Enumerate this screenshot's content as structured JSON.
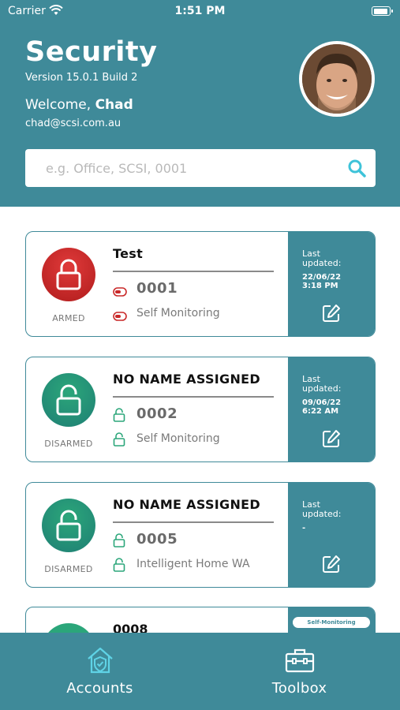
{
  "status_bar": {
    "carrier": "Carrier",
    "time": "1:51 PM"
  },
  "header": {
    "title": "Security",
    "version": "Version 15.0.1 Build 2",
    "welcome_prefix": "Welcome,",
    "user_name": "Chad",
    "email": "chad@scsi.com.au"
  },
  "search": {
    "placeholder": "e.g. Office, SCSI, 0001"
  },
  "colors": {
    "brand": "#3f8a99",
    "armed": "#c92828",
    "disarmed": "#2ba67a"
  },
  "accounts": [
    {
      "name": "Test",
      "state": "ARMED",
      "number": "0001",
      "monitoring": "Self Monitoring",
      "updated_label": "Last updated:",
      "updated_date": "22/06/22",
      "updated_time": "3:18 PM",
      "icon": "locked-icon"
    },
    {
      "name": "NO NAME ASSIGNED",
      "state": "DISARMED",
      "number": "0002",
      "monitoring": "Self Monitoring",
      "updated_label": "Last updated:",
      "updated_date": "09/06/22",
      "updated_time": "6:22 AM",
      "icon": "unlocked-icon"
    },
    {
      "name": "NO NAME ASSIGNED",
      "state": "DISARMED",
      "number": "0005",
      "monitoring": "Intelligent Home WA",
      "updated_label": "Last updated:",
      "updated_date": "-",
      "updated_time": "",
      "icon": "unlocked-icon"
    },
    {
      "name": "0008",
      "badge": "Self-Monitoring"
    }
  ],
  "tabs": [
    {
      "label": "Accounts",
      "icon": "house-shield-icon",
      "active": true
    },
    {
      "label": "Toolbox",
      "icon": "toolbox-icon",
      "active": false
    }
  ]
}
